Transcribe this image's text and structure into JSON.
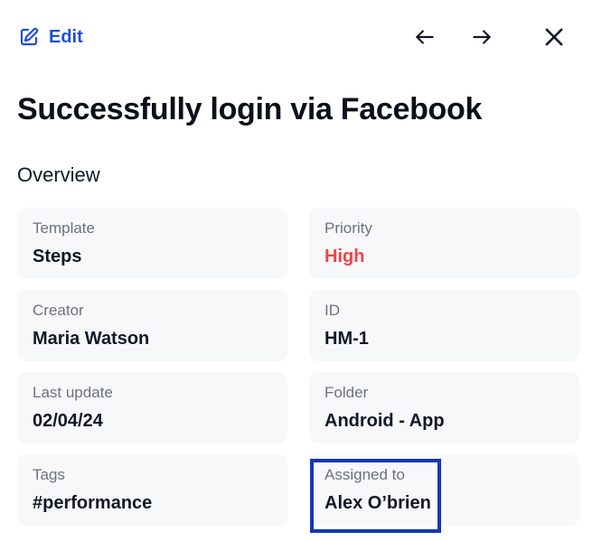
{
  "header": {
    "edit_label": "Edit",
    "icons": {
      "edit": "edit-icon",
      "prev": "arrow-left-icon",
      "next": "arrow-right-icon",
      "close": "close-icon"
    },
    "accent_color": "#1d4ed8"
  },
  "title": "Successfully login via Facebook",
  "overview": {
    "heading": "Overview",
    "fields": {
      "template": {
        "label": "Template",
        "value": "Steps"
      },
      "priority": {
        "label": "Priority",
        "value": "High",
        "color": "#ef4444"
      },
      "creator": {
        "label": "Creator",
        "value": "Maria Watson"
      },
      "id": {
        "label": "ID",
        "value": "HM-1"
      },
      "last_update": {
        "label": "Last update",
        "value": "02/04/24"
      },
      "folder": {
        "label": "Folder",
        "value": "Android - App"
      },
      "tags": {
        "label": "Tags",
        "value": "#performance"
      },
      "assigned_to": {
        "label": "Assigned to",
        "value": "Alex O’brien"
      }
    }
  },
  "highlight_color": "#1536b8"
}
